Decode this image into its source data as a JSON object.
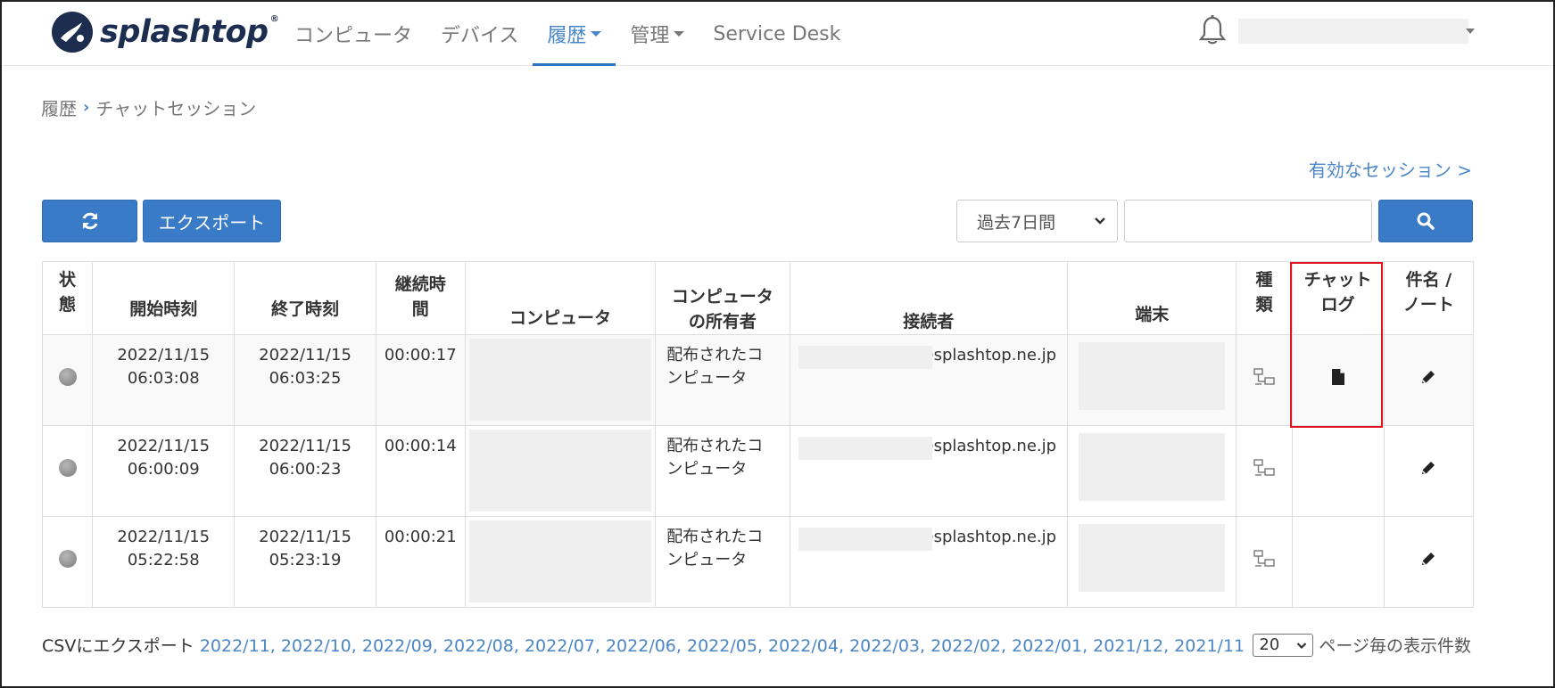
{
  "brand": {
    "name": "splashtop",
    "tm": "®"
  },
  "nav": {
    "items": [
      {
        "label": "コンピュータ",
        "dropdown": false,
        "active": false
      },
      {
        "label": "デバイス",
        "dropdown": false,
        "active": false
      },
      {
        "label": "履歴",
        "dropdown": true,
        "active": true
      },
      {
        "label": "管理",
        "dropdown": true,
        "active": false
      },
      {
        "label": "Service Desk",
        "dropdown": false,
        "active": false
      }
    ]
  },
  "breadcrumb": {
    "parent": "履歴",
    "current": "チャットセッション"
  },
  "active_sessions_link": "有効なセッション >",
  "toolbar": {
    "export_label": "エクスポート",
    "period_value": "過去7日間",
    "search_value": ""
  },
  "table": {
    "headers": {
      "state": "状\n態",
      "start": "開始時刻",
      "end": "終了時刻",
      "duration": "継続時\n間",
      "computer": "コンピュータ",
      "owner": "コンピュータ\nの所有者",
      "user": "接続者",
      "terminal": "端末",
      "type": "種\n類",
      "chat_log": "チャット\nログ",
      "note": "件名 /\nノート"
    },
    "rows": [
      {
        "start": "2022/11/15\n06:03:08",
        "end": "2022/11/15\n06:03:25",
        "duration": "00:00:17",
        "owner": "配布されたコ\nンピュータ",
        "user": "@splashtop.ne.jp",
        "chat_log": true
      },
      {
        "start": "2022/11/15\n06:00:09",
        "end": "2022/11/15\n06:00:23",
        "duration": "00:00:14",
        "owner": "配布されたコ\nンピュータ",
        "user": "@splashtop.ne.jp",
        "chat_log": false
      },
      {
        "start": "2022/11/15\n05:22:58",
        "end": "2022/11/15\n05:23:19",
        "duration": "00:00:21",
        "owner": "配布されたコ\nンピュータ",
        "user": "@splashtop.ne.jp",
        "chat_log": false
      }
    ]
  },
  "footer": {
    "csv_label": "CSVにエクスポート",
    "csv_months": [
      "2022/11",
      "2022/10",
      "2022/09",
      "2022/08",
      "2022/07",
      "2022/06",
      "2022/05",
      "2022/04",
      "2022/03",
      "2022/02",
      "2022/01",
      "2021/12",
      "2021/11"
    ],
    "page_size": "20",
    "page_size_label": "ページ毎の表示件数"
  },
  "colors": {
    "accent": "#3a7bc8",
    "link": "#4a86c8",
    "highlight": "#e0141e"
  },
  "icons": {
    "refresh": "refresh-icon",
    "search": "search-icon",
    "bell": "bell-icon",
    "type": "remote-connection-icon",
    "chat_log": "document-icon",
    "note": "pencil-icon"
  }
}
